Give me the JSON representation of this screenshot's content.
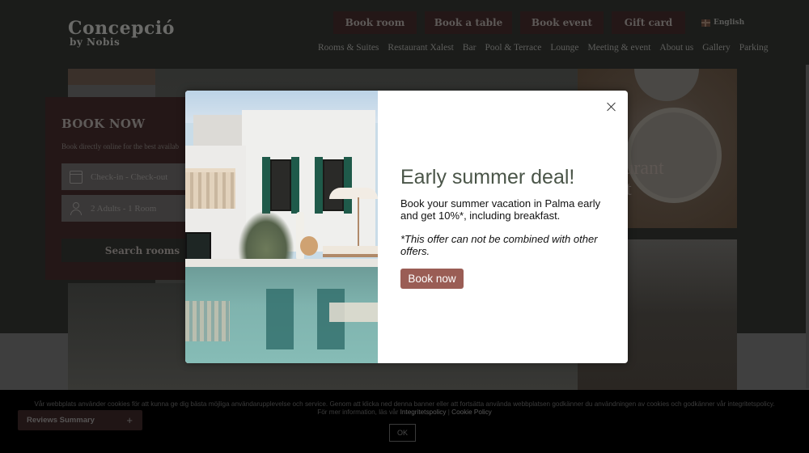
{
  "header": {
    "logo": {
      "main": "Concepció",
      "sub": "by Nobis"
    },
    "top_buttons": [
      "Book room",
      "Book a table",
      "Book event",
      "Gift card"
    ],
    "language": {
      "label": "English",
      "icon": "uk-flag-icon"
    },
    "nav": [
      "Rooms & Suites",
      "Restaurant Xalest",
      "Bar",
      "Pool & Terrace",
      "Lounge",
      "Meeting & event",
      "About us",
      "Gallery",
      "Parking"
    ]
  },
  "booking": {
    "title": "BOOK NOW",
    "subtitle": "Book directly online for the best availab",
    "dates_placeholder": "Check-in - Check-out",
    "guests_value": "2 Adults - 1 Room",
    "search_label": "Search rooms"
  },
  "restaurant_tile": {
    "label_line1": "taurant",
    "label_line2": "est"
  },
  "modal": {
    "title": "Early summer deal!",
    "text": "Book your summer vacation in Palma early and get 10%*, including breakfast.",
    "note": "*This offer can not be combined with other offers.",
    "cta": "Book now",
    "close_icon": "close-icon",
    "cta_color": "#9a5d55"
  },
  "cookie_banner": {
    "text_line1": "Vår webbplats använder cookies för att kunna ge dig bästa möjliga användarupplevelse och service. Genom att klicka ned denna banner eller att fortsätta använda webbplatsen godkänner du användningen av cookies och godkänner vår integritetspolicy.",
    "text_line2_prefix": "För mer information, läs vår ",
    "link_privacy": "Integritetspolicy",
    "separator": " | ",
    "link_cookie": "Cookie Policy",
    "ok_label": "OK"
  },
  "reviews_widget": {
    "label": "Reviews Summary",
    "toggle": "+"
  }
}
